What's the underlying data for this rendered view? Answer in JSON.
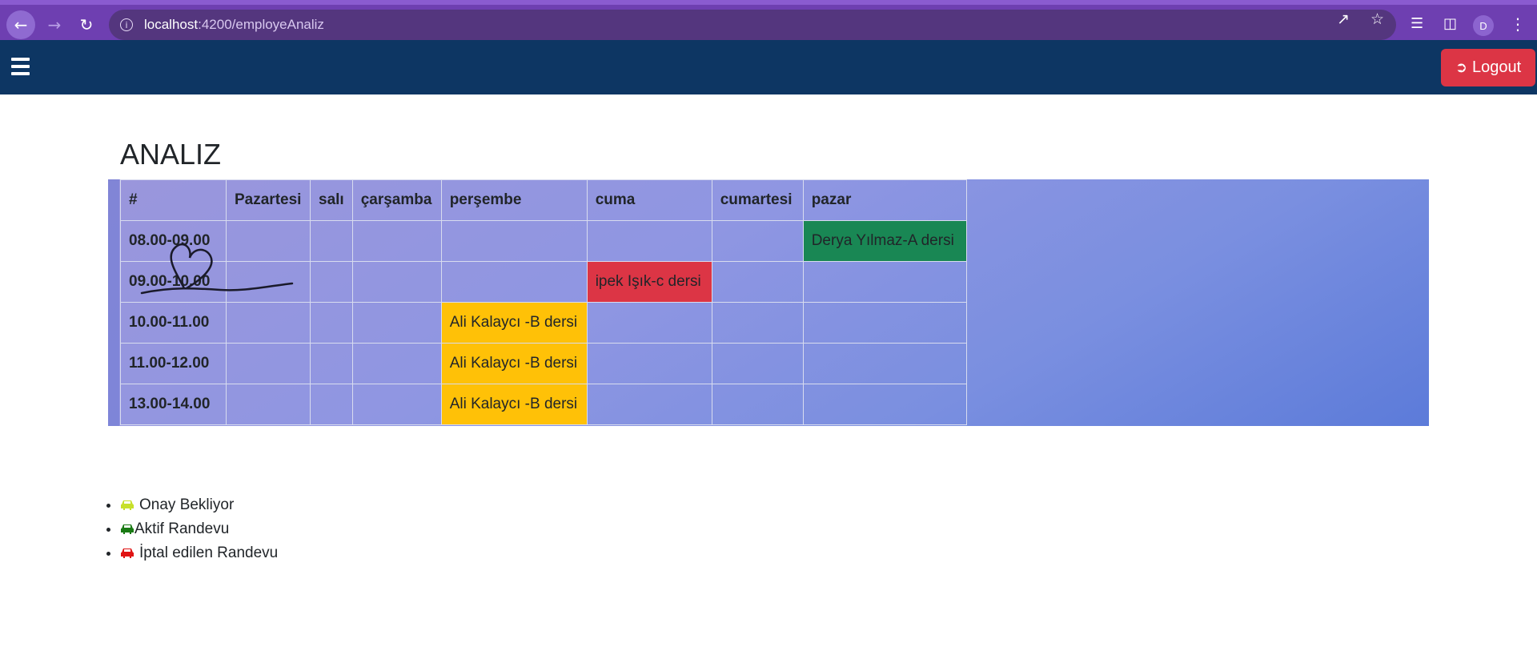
{
  "browser": {
    "url_host": "localhost",
    "url_path": ":4200/employeAnaliz",
    "profile_initial": "D"
  },
  "navbar": {
    "logout_label": "Logout"
  },
  "page": {
    "title": "ANALIZ"
  },
  "schedule": {
    "headers": [
      "#",
      "Pazartesi",
      "salı",
      "çarşamba",
      "perşembe",
      "cuma",
      "cumartesi",
      "pazar"
    ],
    "rows": [
      {
        "time": "08.00-09.00",
        "cells": [
          "",
          "",
          "",
          "",
          "",
          "",
          "Derya Yılmaz-A dersi"
        ]
      },
      {
        "time": "09.00-10.00",
        "cells": [
          "",
          "",
          "",
          "",
          "ipek Işık-c dersi",
          "",
          ""
        ]
      },
      {
        "time": "10.00-11.00",
        "cells": [
          "",
          "",
          "",
          "Ali Kalaycı -B dersi",
          "",
          "",
          ""
        ]
      },
      {
        "time": "11.00-12.00",
        "cells": [
          "",
          "",
          "",
          "Ali Kalaycı -B dersi",
          "",
          "",
          ""
        ]
      },
      {
        "time": "13.00-14.00",
        "cells": [
          "",
          "",
          "",
          "Ali Kalaycı -B dersi",
          "",
          "",
          ""
        ]
      }
    ]
  },
  "legend": {
    "items": [
      {
        "label": "Onay Bekliyor",
        "icon": "car-icon",
        "color": "#c7e02a"
      },
      {
        "label": "Aktif Randevu",
        "icon": "car-icon",
        "color": "#1a7a14"
      },
      {
        "label": "İptal edilen Randevu",
        "icon": "car-icon",
        "color": "#e01414"
      }
    ]
  },
  "colors": {
    "chrome": "#6e3fb1",
    "navbar": "#0d3663",
    "danger": "#dc3545",
    "warning": "#ffc107",
    "success": "#198754"
  }
}
